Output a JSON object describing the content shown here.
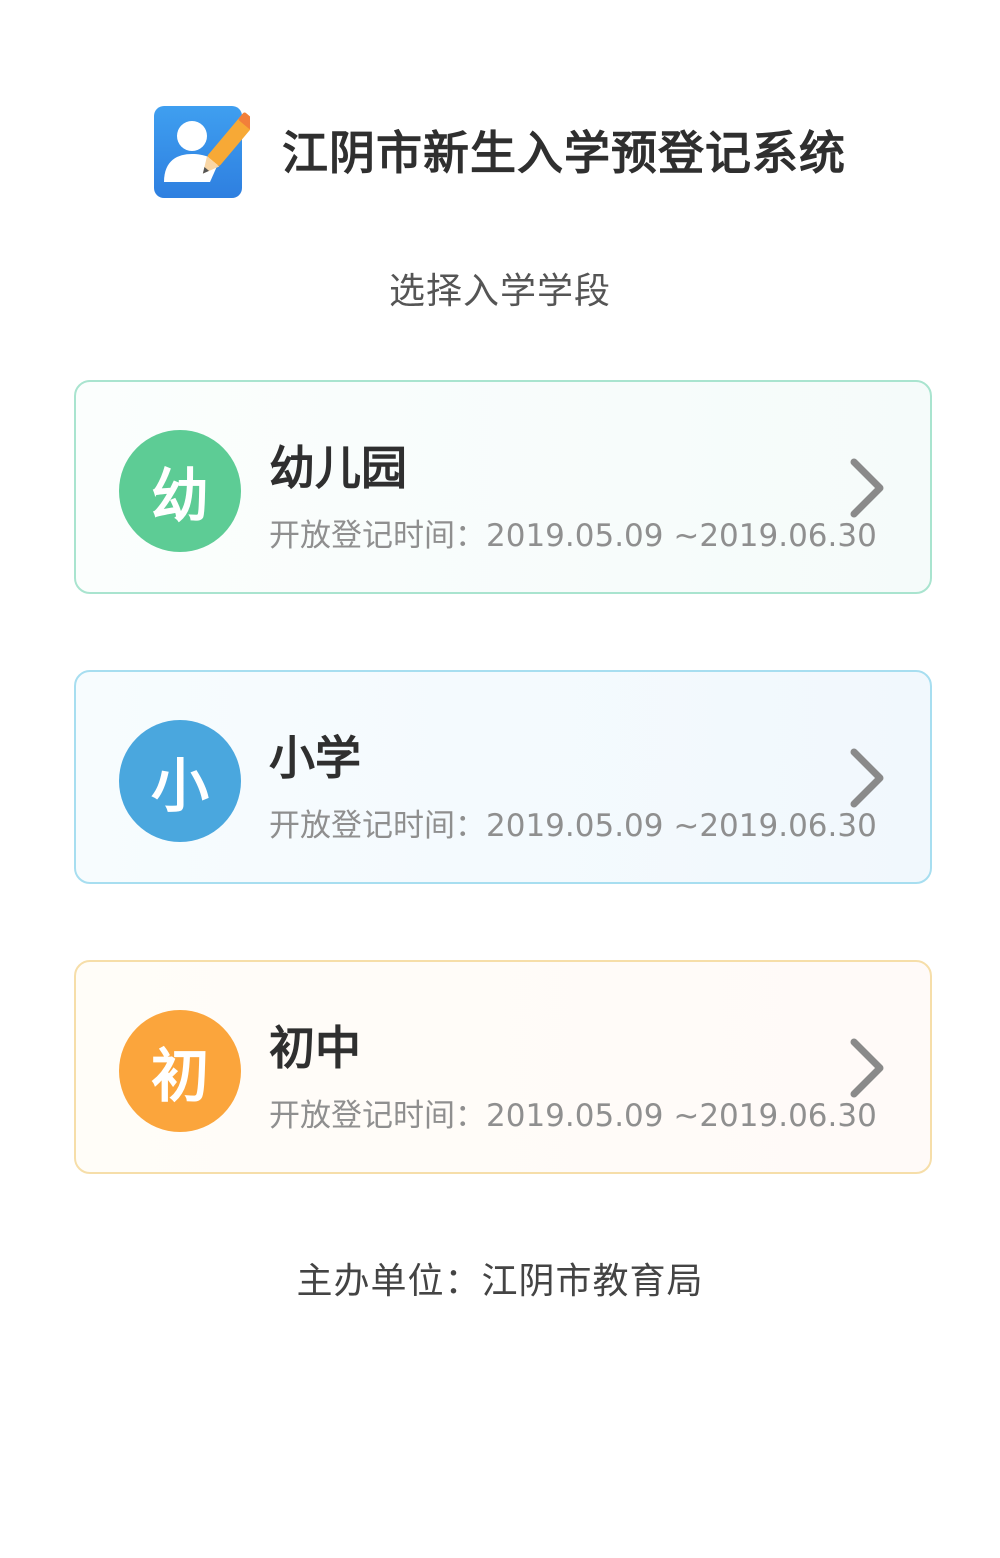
{
  "header": {
    "title": "江阴市新生入学预登记系统",
    "logo_icon": "user-edit-icon"
  },
  "subtitle": "选择入学学段",
  "stages": [
    {
      "badge": "幼",
      "name": "幼儿园",
      "period_label": "开放登记时间：",
      "period": "2019.05.09 ~2019.06.30",
      "color": "#5dcc95"
    },
    {
      "badge": "小",
      "name": "小学",
      "period_label": "开放登记时间：",
      "period": "2019.05.09 ~2019.06.30",
      "color": "#4aa7de"
    },
    {
      "badge": "初",
      "name": "初中",
      "period_label": "开放登记时间：",
      "period": "2019.05.09 ~2019.06.30",
      "color": "#fba53c"
    }
  ],
  "footer": {
    "label": "主办单位：",
    "org": "江阴市教育局"
  }
}
